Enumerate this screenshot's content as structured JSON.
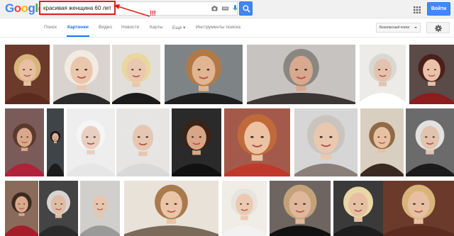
{
  "header": {
    "logo_letters": [
      {
        "char": "G",
        "color": "#4285f4"
      },
      {
        "char": "o",
        "color": "#ea4335"
      },
      {
        "char": "o",
        "color": "#fbbc05"
      },
      {
        "char": "g",
        "color": "#4285f4"
      },
      {
        "char": "l",
        "color": "#34a853"
      },
      {
        "char": "e",
        "color": "#ea4335"
      }
    ],
    "search_query": "красивая женщина 60 лет",
    "annotation_text": "!!!",
    "signin_label": "Войти"
  },
  "tabs": [
    {
      "label": "Поиск",
      "active": false
    },
    {
      "label": "Картинки",
      "active": true
    },
    {
      "label": "Видео",
      "active": false
    },
    {
      "label": "Новости",
      "active": false
    },
    {
      "label": "Карты",
      "active": false
    },
    {
      "label": "Ещё ▾",
      "active": false
    },
    {
      "label": "Инструменты поиска",
      "active": false
    }
  ],
  "safe_search_label": "Безопасный поиск",
  "colors": {
    "accent": "#4285f4",
    "annotation": "#e0201a",
    "active_tab": "#1a73e8"
  },
  "image_results": [
    {
      "bg": "#6b3a2a",
      "hair": "#d8b47a",
      "skin": "#e7bfa3",
      "cloth": "#5c2b20"
    },
    {
      "bg": "#d9d3cf",
      "hair": "#f1ebe2",
      "skin": "#eac6ad",
      "cloth": "#2a2a2a"
    },
    {
      "bg": "#e2dfdb",
      "hair": "#e9d79f",
      "skin": "#eac7b0",
      "cloth": "#1b1b1b"
    },
    {
      "bg": "#7e8486",
      "hair": "#b07a48",
      "skin": "#e1b591",
      "cloth": "#1f1f1f"
    },
    {
      "bg": "#c7c3c0",
      "hair": "#8a8682",
      "skin": "#d8a98e",
      "cloth": "#3b3633"
    },
    {
      "bg": "#ecebe8",
      "hair": "#d9d7d2",
      "skin": "#e4c2ad",
      "cloth": "#ffffff"
    },
    {
      "bg": "#5a4a48",
      "hair": "#4b1f1a",
      "skin": "#e9c2a8",
      "cloth": "#8b1d1d"
    },
    {
      "bg": "#7b5a5a",
      "hair": "#5a3a2c",
      "skin": "#d9a88a",
      "cloth": "#b0223a"
    },
    {
      "bg": "#3f4448",
      "hair": "#1e1714",
      "skin": "#dfb292",
      "cloth": "#1c1c1c"
    },
    {
      "bg": "#eeeeee",
      "hair": "#f5f5f5",
      "skin": "#e9cfc0",
      "cloth": "#e6e6e6"
    },
    {
      "bg": "#e7e5e3",
      "hair": "#e6e6e6",
      "skin": "#e6c7b2",
      "cloth": "#d9d9d9"
    },
    {
      "bg": "#2a2a2a",
      "hair": "#3a2418",
      "skin": "#d8a687",
      "cloth": "#111111"
    },
    {
      "bg": "#a45a4a",
      "hair": "#c06a3a",
      "skin": "#ecc2a2",
      "cloth": "#c0392b"
    },
    {
      "bg": "#d6d6d6",
      "hair": "#c9c4bd",
      "skin": "#eac8b0",
      "cloth": "#8b7f7a"
    },
    {
      "bg": "#d9cfc0",
      "hair": "#8f6a45",
      "skin": "#e8c0a2",
      "cloth": "#3b2a20"
    },
    {
      "bg": "#6b6b6b",
      "hair": "#e1e1e1",
      "skin": "#e3c3ae",
      "cloth": "#1b1b1b"
    },
    {
      "bg": "#8a6a5a",
      "hair": "#3a2a20",
      "skin": "#d9a98c",
      "cloth": "#a51d2a"
    },
    {
      "bg": "#444444",
      "hair": "#d5d5d5",
      "skin": "#e0bca6",
      "cloth": "#2a2a2a"
    },
    {
      "bg": "#d1cfcb",
      "hair": "#cfcfcf",
      "skin": "#e6c6b0",
      "cloth": "#9a9a9a"
    },
    {
      "bg": "#e9e2d8",
      "hair": "#a87a4e",
      "skin": "#ebc5a8",
      "cloth": "#7a6a5a"
    },
    {
      "bg": "#f0ece6",
      "hair": "#e8e4dd",
      "skin": "#ecc9b1",
      "cloth": "#f2f2f2"
    },
    {
      "bg": "#6e6560",
      "hair": "#c3a27a",
      "skin": "#dfb79b",
      "cloth": "#111111"
    },
    {
      "bg": "#3a3a3a",
      "hair": "#ead7a6",
      "skin": "#e7c0a4",
      "cloth": "#1d1d1d"
    }
  ]
}
